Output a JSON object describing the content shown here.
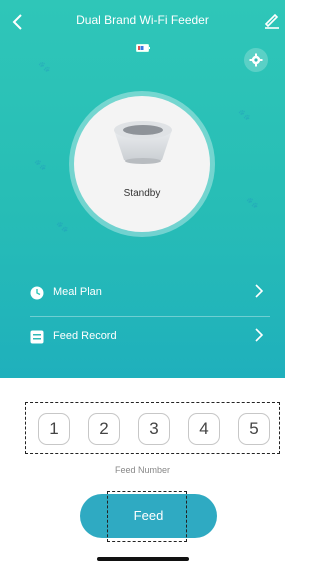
{
  "header": {
    "title": "Dual Brand Wi-Fi Feeder",
    "back_icon": "chevron-left-icon",
    "edit_icon": "pencil-icon"
  },
  "device": {
    "status": "Standby",
    "battery_icon": "battery-icon",
    "settings_icon": "gear-icon"
  },
  "menu": [
    {
      "label": "Meal Plan",
      "icon": "clock-icon"
    },
    {
      "label": "Feed Record",
      "icon": "list-icon"
    }
  ],
  "feed_numbers": [
    "1",
    "2",
    "3",
    "4",
    "5"
  ],
  "feed_number_label": "Feed Number",
  "feed_button": "Feed",
  "colors": {
    "accent": "#2fc6b8",
    "button": "#2faac2"
  }
}
